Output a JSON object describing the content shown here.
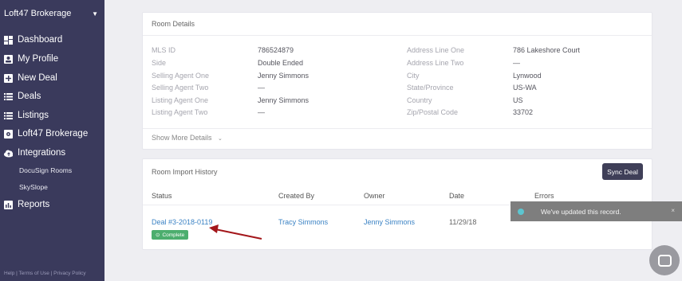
{
  "sidebar": {
    "brand": "Loft47 Brokerage",
    "items": [
      {
        "label": "Dashboard",
        "icon": "dashboard-icon"
      },
      {
        "label": "My Profile",
        "icon": "profile-icon"
      },
      {
        "label": "New Deal",
        "icon": "plus-icon"
      },
      {
        "label": "Deals",
        "icon": "list-icon"
      },
      {
        "label": "Listings",
        "icon": "list-icon"
      },
      {
        "label": "Loft47 Brokerage",
        "icon": "gear-icon"
      },
      {
        "label": "Integrations",
        "icon": "cloud-icon"
      },
      {
        "label": "Reports",
        "icon": "chart-icon"
      }
    ],
    "sub_items": [
      "DocuSign Rooms",
      "SkySlope"
    ],
    "footer": "Help | Terms of Use | Privacy Policy"
  },
  "room_details": {
    "title": "Room Details",
    "left_labels": [
      "MLS ID",
      "Side",
      "Selling Agent One",
      "Selling Agent Two",
      "Listing Agent One",
      "Listing Agent Two"
    ],
    "left_values": [
      "786524879",
      "Double Ended",
      "Jenny Simmons",
      "—",
      "Jenny Simmons",
      "—"
    ],
    "right_labels": [
      "Address Line One",
      "Address Line Two",
      "City",
      "State/Province",
      "Country",
      "Zip/Postal Code"
    ],
    "right_values": [
      "786 Lakeshore Court",
      "—",
      "Lynwood",
      "US-WA",
      "US",
      "33702"
    ],
    "show_more": "Show More Details"
  },
  "import_history": {
    "title": "Room Import History",
    "sync_label": "Sync Deal",
    "columns": [
      "Status",
      "Created By",
      "Owner",
      "Date",
      "Errors"
    ],
    "row": {
      "status": "Deal #3-2018-0119",
      "badge": "Complete",
      "created_by": "Tracy Simmons",
      "owner": "Jenny Simmons",
      "date": "11/29/18"
    }
  },
  "toast": {
    "message": "We've updated this record.",
    "close": "×"
  },
  "colors": {
    "sidebar_bg": "#3a3a5c",
    "accent_link": "#3a82c4",
    "success": "#4cae6e",
    "button_dark": "#3f3f58",
    "toast_bg": "#7e7e7e"
  }
}
